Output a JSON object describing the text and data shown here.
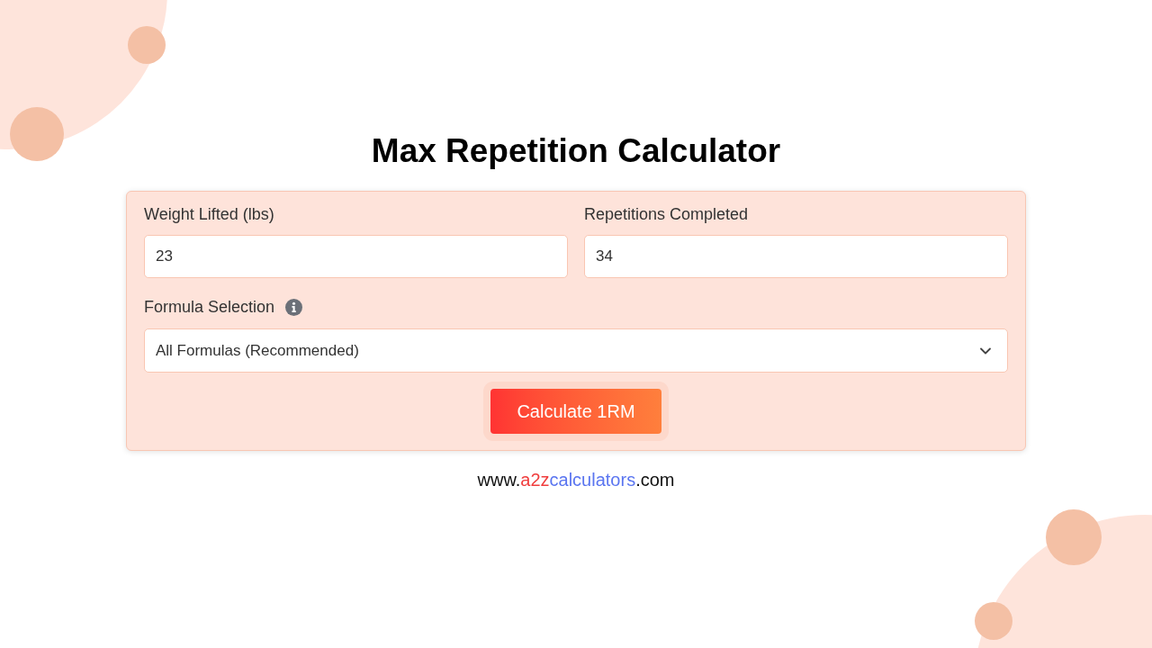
{
  "title": "Max Repetition Calculator",
  "form": {
    "fields": [
      {
        "label": "Weight Lifted (lbs)",
        "value": "23"
      },
      {
        "label": "Repetitions Completed",
        "value": "34"
      }
    ],
    "formula": {
      "label": "Formula Selection",
      "value": "All Formulas (Recommended)"
    },
    "button": "Calculate 1RM"
  },
  "footer": {
    "parts": [
      {
        "text": "www.",
        "color": "#111111"
      },
      {
        "text": "a2z",
        "color": "#f03e3e"
      },
      {
        "text": "calculators",
        "color": "#5a75f0"
      },
      {
        "text": ".com",
        "color": "#111111"
      }
    ]
  }
}
